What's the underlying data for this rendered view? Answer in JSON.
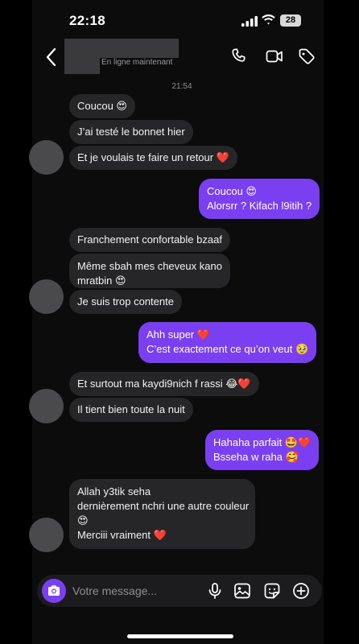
{
  "status_bar": {
    "time": "22:18",
    "battery": "28"
  },
  "header": {
    "status": "En ligne maintenant"
  },
  "date_label": "21:54",
  "messages": [
    {
      "side": "in",
      "text": "Coucou 😍"
    },
    {
      "side": "in",
      "text": "J’ai testé le bonnet hier"
    },
    {
      "side": "in",
      "text": "Et je voulais te faire un retour ❤️"
    },
    {
      "side": "out",
      "lines": [
        "Coucou 😍",
        "Alorsrr ? Kifach l9itih ?"
      ]
    },
    {
      "side": "in",
      "text": "Franchement confortable bzaaf"
    },
    {
      "side": "in",
      "lines": [
        "Même sbah mes cheveux kano",
        "mratbin 😍"
      ]
    },
    {
      "side": "in",
      "text": "Je suis trop contente"
    },
    {
      "side": "out",
      "lines": [
        "Ahh super ❤️",
        "C’est exactement ce qu’on veut 🥹"
      ]
    },
    {
      "side": "in",
      "text": "Et surtout ma kaydi9nich f rassi 😂❤️"
    },
    {
      "side": "in",
      "text": "Il tient bien toute la nuit"
    },
    {
      "side": "out",
      "lines": [
        "Hahaha parfait 🤩❤️",
        "Bsseha w raha 🥰"
      ]
    },
    {
      "side": "in",
      "lines": [
        "Allah y3tik seha",
        "dernièrement nchri une autre couleur",
        "😍",
        "Merciii vraiment ❤️"
      ]
    }
  ],
  "composer": {
    "placeholder": "Votre message..."
  },
  "colors": {
    "accent": "#7b3ff2",
    "incoming_bubble": "#262628",
    "background": "#0c0c0d"
  }
}
